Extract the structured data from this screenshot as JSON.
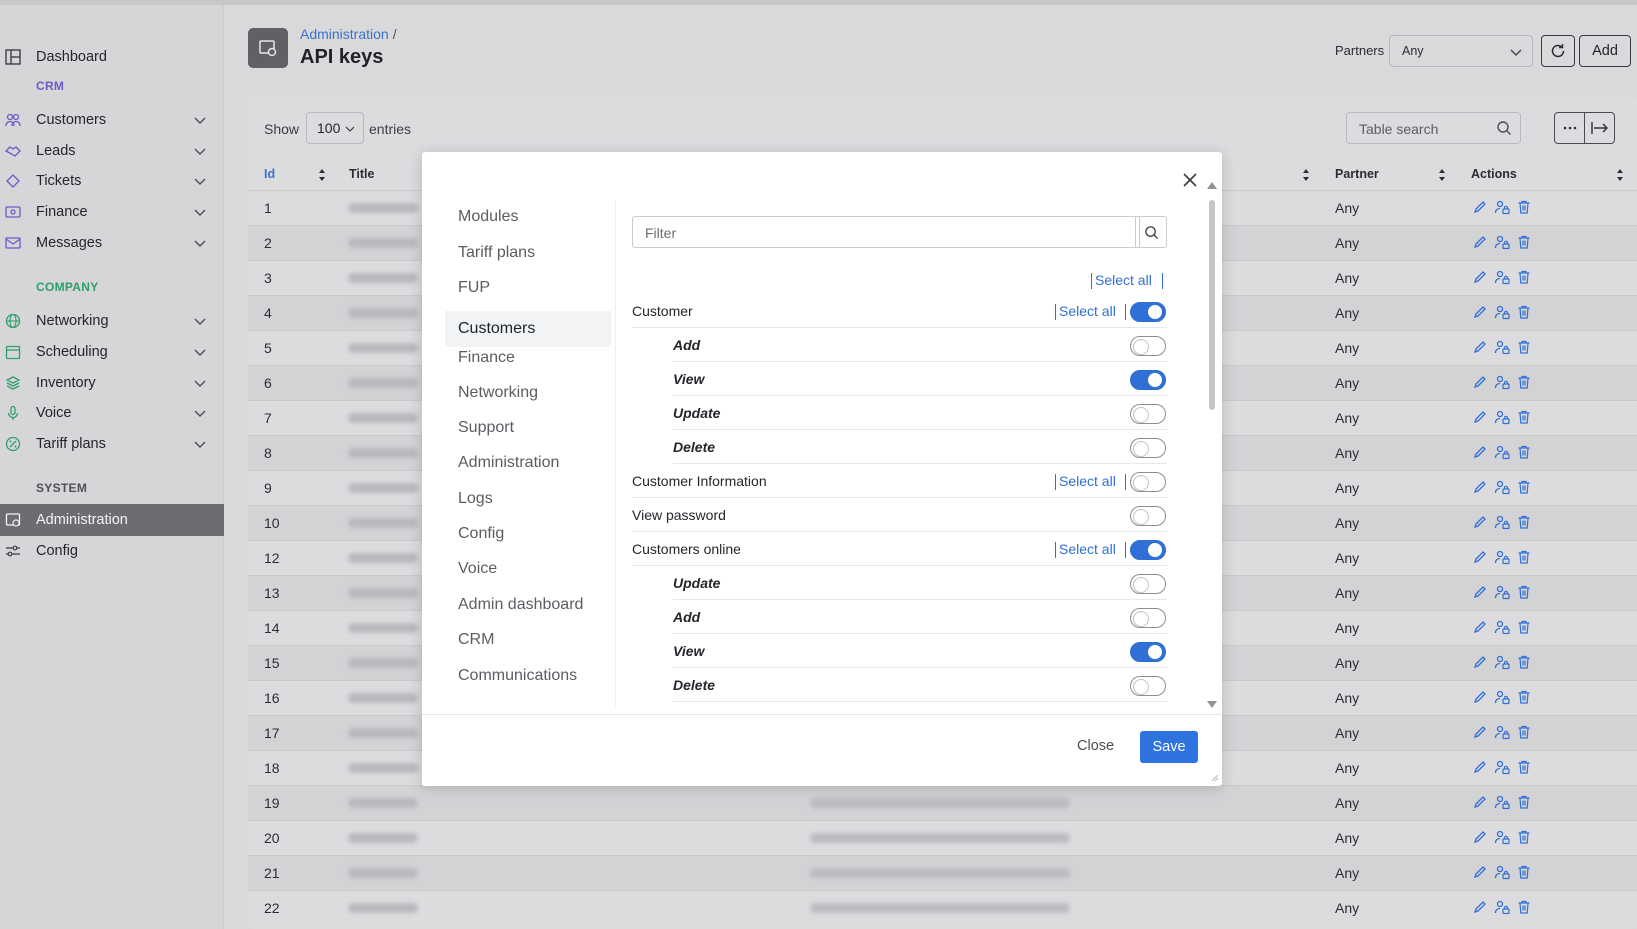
{
  "sidebar": {
    "dashboard": "Dashboard",
    "crm_section": "CRM",
    "customers": "Customers",
    "leads": "Leads",
    "tickets": "Tickets",
    "finance": "Finance",
    "messages": "Messages",
    "company_section": "COMPANY",
    "networking": "Networking",
    "scheduling": "Scheduling",
    "inventory": "Inventory",
    "voice": "Voice",
    "tariff_plans": "Tariff plans",
    "system_section": "SYSTEM",
    "administration": "Administration",
    "config": "Config"
  },
  "header": {
    "breadcrumb": "Administration",
    "breadcrumb_sep": "/",
    "title": "API keys",
    "partners_label": "Partners",
    "partners_value": "Any",
    "add_label": "Add"
  },
  "table": {
    "show_label": "Show",
    "show_value": "100",
    "entries_label": "entries",
    "search_placeholder": "Table search",
    "col_id": "Id",
    "col_title": "Title",
    "col_partner": "Partner",
    "col_actions": "Actions",
    "rows": [
      {
        "id": "1",
        "partner": "Any"
      },
      {
        "id": "2",
        "partner": "Any"
      },
      {
        "id": "3",
        "partner": "Any"
      },
      {
        "id": "4",
        "partner": "Any"
      },
      {
        "id": "5",
        "partner": "Any"
      },
      {
        "id": "6",
        "partner": "Any"
      },
      {
        "id": "7",
        "partner": "Any"
      },
      {
        "id": "8",
        "partner": "Any"
      },
      {
        "id": "9",
        "partner": "Any"
      },
      {
        "id": "10",
        "partner": "Any"
      },
      {
        "id": "12",
        "partner": "Any"
      },
      {
        "id": "13",
        "partner": "Any"
      },
      {
        "id": "14",
        "partner": "Any"
      },
      {
        "id": "15",
        "partner": "Any"
      },
      {
        "id": "16",
        "partner": "Any"
      },
      {
        "id": "17",
        "partner": "Any"
      },
      {
        "id": "18",
        "partner": "Any"
      },
      {
        "id": "19",
        "partner": "Any"
      },
      {
        "id": "20",
        "partner": "Any"
      },
      {
        "id": "21",
        "partner": "Any"
      },
      {
        "id": "22",
        "partner": "Any"
      }
    ]
  },
  "modal": {
    "categories": [
      "Modules",
      "Tariff plans",
      "FUP",
      "Customers",
      "Finance",
      "Networking",
      "Support",
      "Administration",
      "Logs",
      "Config",
      "Voice",
      "Admin dashboard",
      "CRM",
      "Communications"
    ],
    "active_category": "Customers",
    "filter_placeholder": "Filter",
    "select_all": "Select all",
    "permissions": [
      {
        "label": "Customer",
        "sub": false,
        "on": true,
        "select_all": true
      },
      {
        "label": "Add",
        "sub": true,
        "on": false
      },
      {
        "label": "View",
        "sub": true,
        "on": true
      },
      {
        "label": "Update",
        "sub": true,
        "on": false
      },
      {
        "label": "Delete",
        "sub": true,
        "on": false
      },
      {
        "label": "Customer Information",
        "sub": false,
        "on": false,
        "select_all": true
      },
      {
        "label": "View password",
        "sub": false,
        "on": false
      },
      {
        "label": "Customers online",
        "sub": false,
        "on": true,
        "select_all": true
      },
      {
        "label": "Update",
        "sub": true,
        "on": false
      },
      {
        "label": "Add",
        "sub": true,
        "on": false
      },
      {
        "label": "View",
        "sub": true,
        "on": true
      },
      {
        "label": "Delete",
        "sub": true,
        "on": false
      }
    ],
    "close_label": "Close",
    "save_label": "Save"
  },
  "colors": {
    "accent": "#2f73e0",
    "crm": "#6a5bc5",
    "company": "#2e9e6a"
  }
}
